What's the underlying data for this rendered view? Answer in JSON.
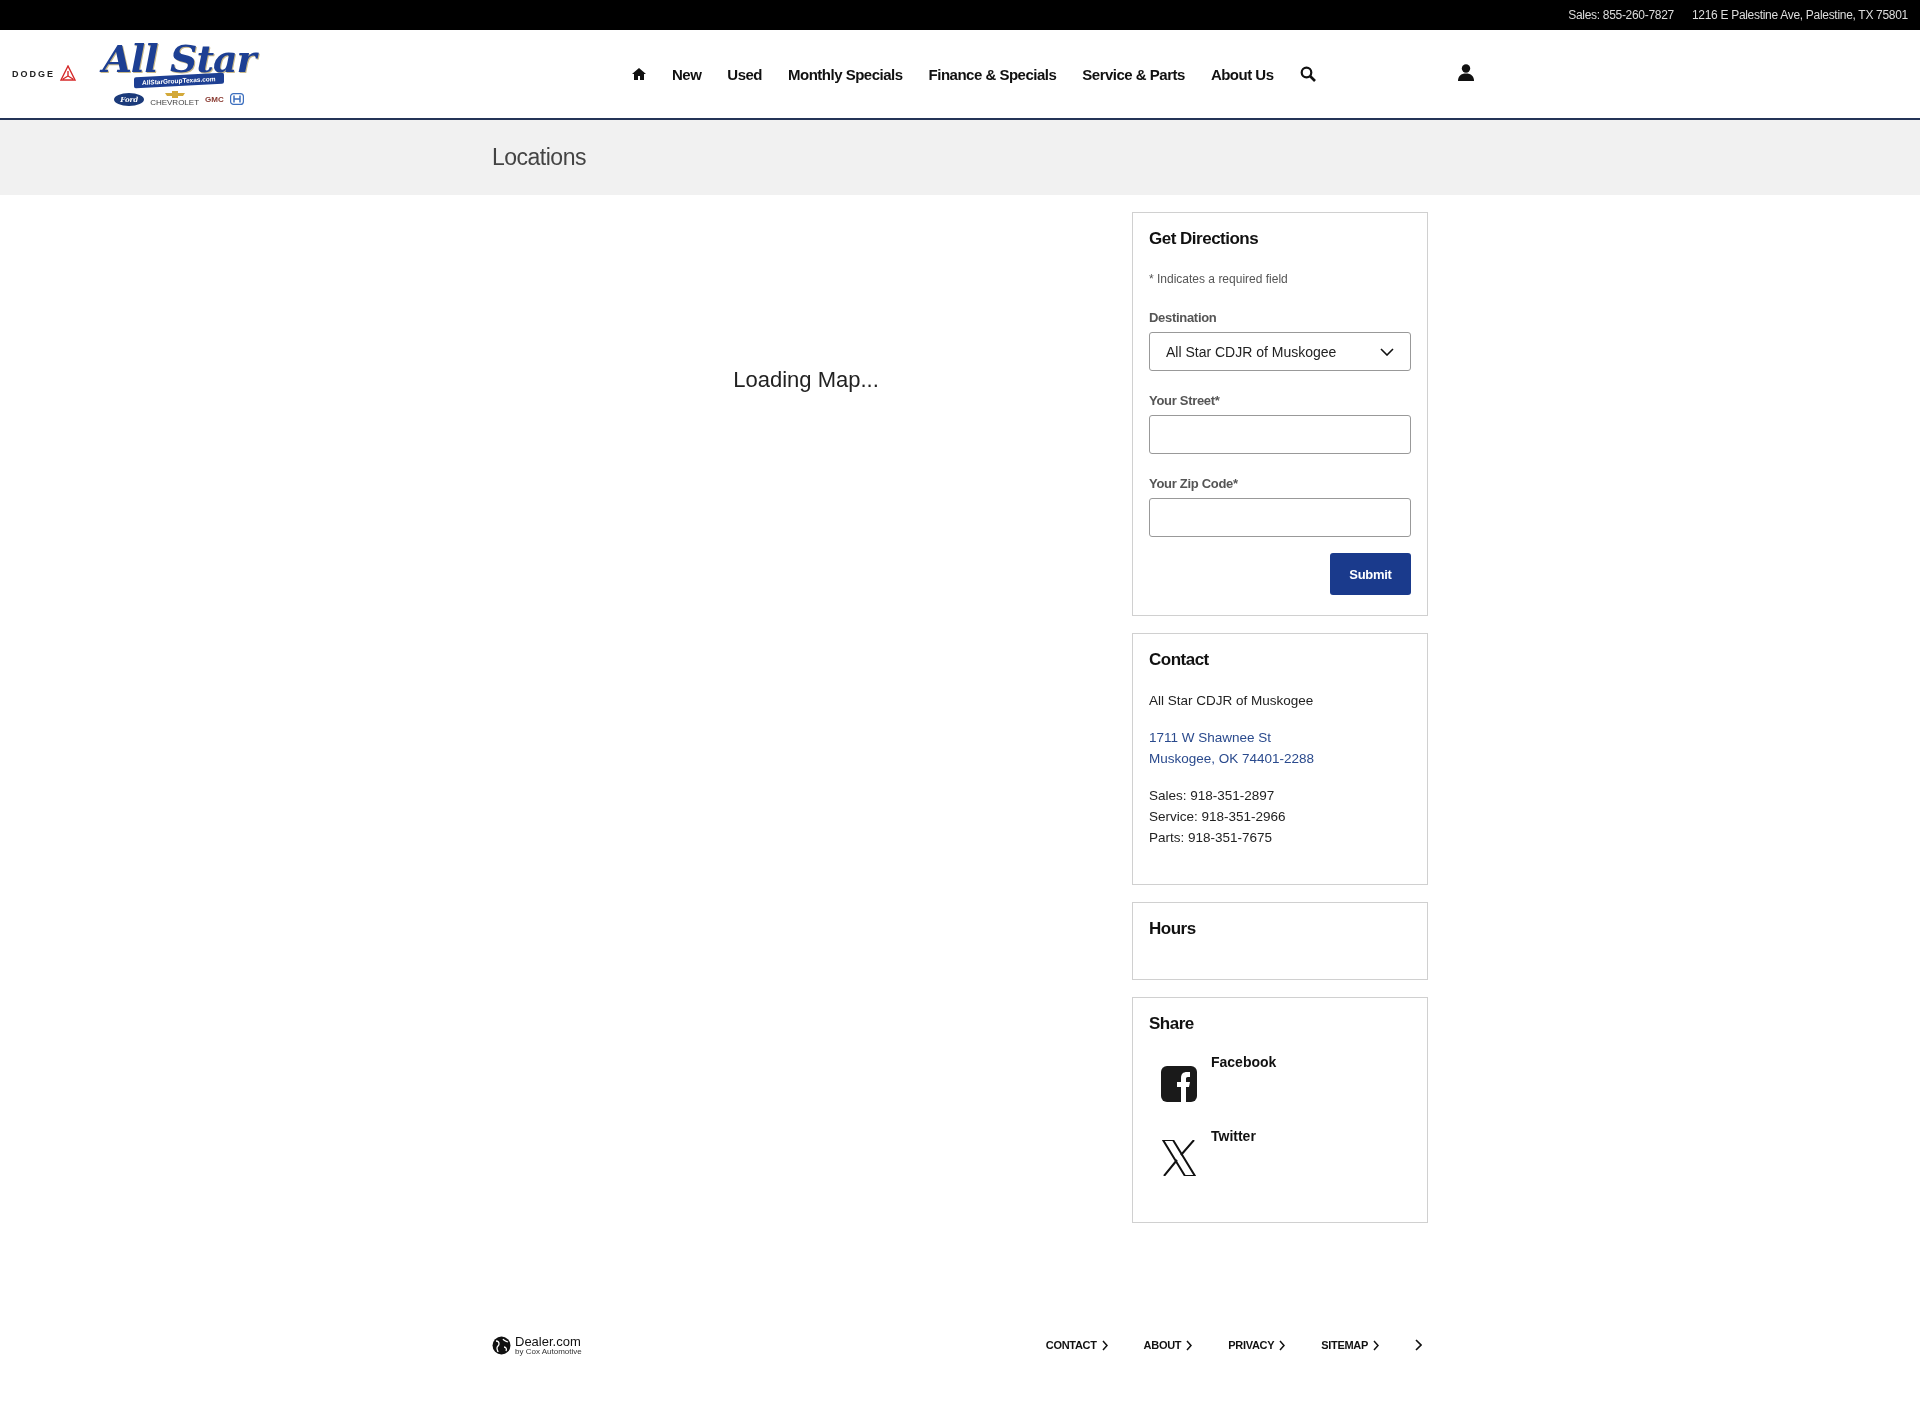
{
  "top_bar": {
    "sales_label": "Sales:",
    "sales_phone": "855-260-7827",
    "address": "1216 E Palestine Ave, Palestine, TX 75801"
  },
  "header": {
    "logo": {
      "dodge": "DODGE",
      "brand": "All Star",
      "website": "AllStarGroupTexas.com",
      "makes": [
        "Ford",
        "CHEVROLET",
        "GMC"
      ]
    },
    "nav": [
      {
        "kind": "home"
      },
      {
        "kind": "link",
        "label": "New"
      },
      {
        "kind": "link",
        "label": "Used"
      },
      {
        "kind": "link",
        "label": "Monthly Specials"
      },
      {
        "kind": "link",
        "label": "Finance & Specials"
      },
      {
        "kind": "link",
        "label": "Service & Parts"
      },
      {
        "kind": "link",
        "label": "About Us"
      },
      {
        "kind": "search"
      }
    ]
  },
  "page_title": "Locations",
  "map": {
    "status": "Loading Map..."
  },
  "directions": {
    "title": "Get Directions",
    "required_note": "* Indicates a required field",
    "fields": [
      {
        "kind": "select",
        "label": "Destination",
        "value": "All Star CDJR of Muskogee"
      },
      {
        "kind": "text",
        "label": "Your Street*"
      },
      {
        "kind": "text",
        "label": "Your Zip Code*"
      }
    ],
    "submit": "Submit"
  },
  "contact": {
    "title": "Contact",
    "name": "All Star CDJR of Muskogee",
    "address_lines": [
      "1711 W Shawnee St",
      "Muskogee, OK 74401-2288"
    ],
    "phones": [
      "Sales: 918-351-2897",
      "Service: 918-351-2966",
      "Parts: 918-351-7675"
    ]
  },
  "hours": {
    "title": "Hours"
  },
  "share": {
    "title": "Share",
    "items": [
      {
        "kind": "facebook",
        "label": "Facebook"
      },
      {
        "kind": "twitter",
        "label": "Twitter"
      }
    ]
  },
  "footer": {
    "brand": "Dealer.com",
    "brand_sub": "by Cox Automotive",
    "links": [
      "CONTACT",
      "ABOUT",
      "PRIVACY",
      "SITEMAP"
    ]
  }
}
